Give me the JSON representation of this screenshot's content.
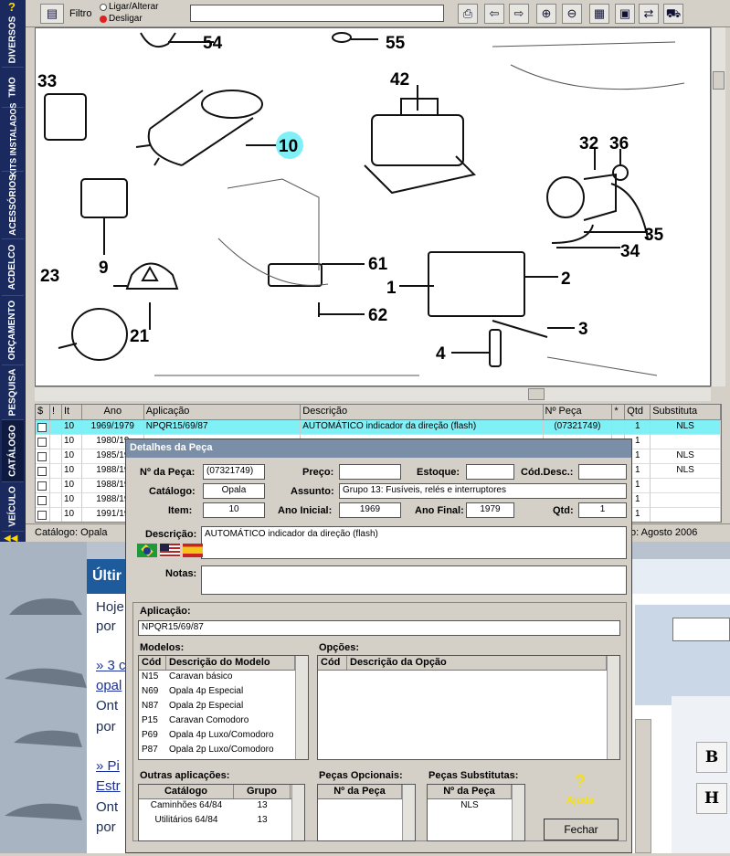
{
  "sidebar": {
    "help": "?",
    "tabs": [
      "DIVERSOS",
      "TMO",
      "KITS INSTALADOS",
      "ACESSÓRIOS",
      "ACDELCO",
      "ORÇAMENTO",
      "PESQUISA",
      "CATÁLOGO",
      "VEÍCULO"
    ],
    "collapse": "◀◀"
  },
  "toolbar": {
    "filter_label": "Filtro",
    "radio_on": "Ligar/Alterar",
    "radio_off": "Desligar",
    "filter_value": ""
  },
  "drawing": {
    "callouts": [
      "54",
      "55",
      "33",
      "42",
      "10",
      "32",
      "36",
      "35",
      "34",
      "9",
      "23",
      "61",
      "2",
      "1",
      "62",
      "3",
      "21",
      "4"
    ],
    "highlighted_callout": "10",
    "highlight_color": "#7ff0f6"
  },
  "grid": {
    "headers": [
      "$",
      "!",
      "It",
      "Ano",
      "Aplicação",
      "Descrição",
      "Nº Peça",
      "*",
      "Qtd",
      "Substituta"
    ],
    "rows": [
      {
        "it": "10",
        "ano": "1969/1979",
        "aplic": "NPQR15/69/87",
        "desc": "AUTOMÁTICO indicador da direção (flash)",
        "peca": "(07321749)",
        "qtd": "1",
        "subst": "NLS"
      },
      {
        "it": "10",
        "ano": "1980/19",
        "aplic": "",
        "desc": "",
        "peca": "",
        "qtd": "1",
        "subst": ""
      },
      {
        "it": "10",
        "ano": "1985/19",
        "aplic": "",
        "desc": "",
        "peca": "",
        "qtd": "1",
        "subst": "NLS"
      },
      {
        "it": "10",
        "ano": "1988/19",
        "aplic": "",
        "desc": "",
        "peca": "",
        "qtd": "1",
        "subst": "NLS"
      },
      {
        "it": "10",
        "ano": "1988/19",
        "aplic": "",
        "desc": "",
        "peca": "",
        "qtd": "1",
        "subst": ""
      },
      {
        "it": "10",
        "ano": "1988/19",
        "aplic": "",
        "desc": "",
        "peca": "",
        "qtd": "1",
        "subst": ""
      },
      {
        "it": "10",
        "ano": "1991/19",
        "aplic": "",
        "desc": "",
        "peca": "",
        "qtd": "1",
        "subst": ""
      }
    ]
  },
  "status": {
    "left": "Catálogo: Opala",
    "right": "o: Agosto 2006"
  },
  "web": {
    "heading": "Últir",
    "p1a": "Hoje",
    "p1b": "por",
    "link1": "» 3 c",
    "link1b": "opal",
    "p2a": "Ont",
    "p2b": "por",
    "link2": "» Pi",
    "link2b": "Estr",
    "p3a": "Ont",
    "p3b": "por",
    "btn_b": "B",
    "btn_h": "H"
  },
  "dialog": {
    "title": "Detalhes da Peça",
    "labels": {
      "num_peca": "Nº da Peça:",
      "preco": "Preço:",
      "estoque": "Estoque:",
      "cod_desc": "Cód.Desc.:",
      "catalogo": "Catálogo:",
      "assunto": "Assunto:",
      "item": "Item:",
      "ano_ini": "Ano Inicial:",
      "ano_fim": "Ano Final:",
      "qtd": "Qtd:",
      "descricao": "Descrição:",
      "notas": "Notas:",
      "aplicacao": "Aplicação:",
      "modelos": "Modelos:",
      "opcoes": "Opções:",
      "outras": "Outras aplicações:",
      "opcionais": "Peças Opcionais:",
      "substitutas": "Peças Substitutas:"
    },
    "values": {
      "num_peca": "(07321749)",
      "preco": "",
      "estoque": "",
      "cod_desc": "",
      "catalogo": "Opala",
      "assunto": "Grupo 13: Fusíveis, relés e interruptores",
      "item": "10",
      "ano_ini": "1969",
      "ano_fim": "1979",
      "qtd": "1",
      "descricao": "AUTOMÁTICO indicador da direção (flash)",
      "notas": "",
      "aplicacao": "NPQR15/69/87"
    },
    "modelos": {
      "headers": [
        "Cód",
        "Descrição do Modelo"
      ],
      "rows": [
        [
          "N15",
          "Caravan básico"
        ],
        [
          "N69",
          "Opala 4p Especial"
        ],
        [
          "N87",
          "Opala 2p Especial"
        ],
        [
          "P15",
          "Caravan Comodoro"
        ],
        [
          "P69",
          "Opala 4p Luxo/Comodoro"
        ],
        [
          "P87",
          "Opala 2p Luxo/Comodoro"
        ]
      ]
    },
    "opcoes": {
      "headers": [
        "Cód",
        "Descrição da Opção"
      ]
    },
    "outras": {
      "headers": [
        "Catálogo",
        "Grupo"
      ],
      "rows": [
        [
          "Caminhões 64/84",
          "13"
        ],
        [
          "Utilitários 64/84",
          "13"
        ]
      ]
    },
    "opcionais": {
      "header": "Nº da Peça"
    },
    "substitutas": {
      "header": "Nº da Peça",
      "rows": [
        "NLS"
      ]
    },
    "help_icon": "?",
    "help_label": "Ajuda",
    "close_label": "Fechar"
  }
}
